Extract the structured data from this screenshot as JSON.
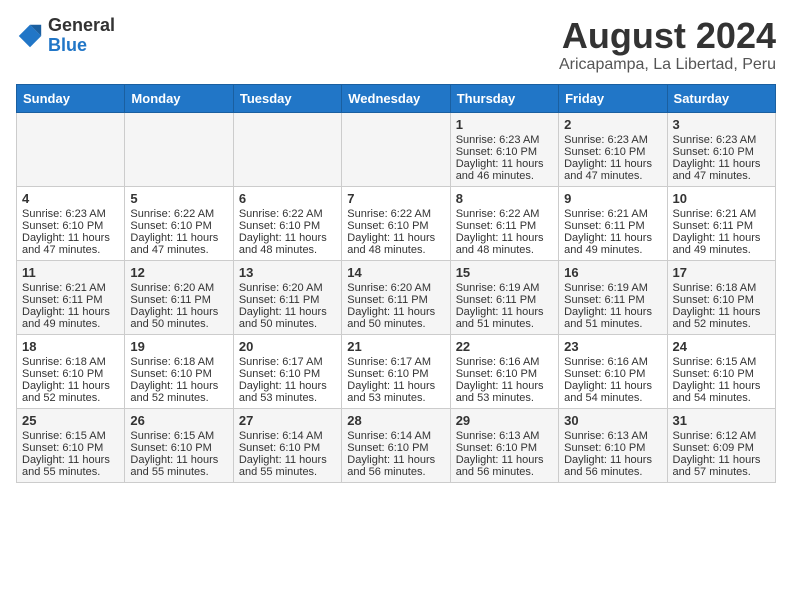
{
  "header": {
    "logo_line1": "General",
    "logo_line2": "Blue",
    "title": "August 2024",
    "subtitle": "Aricapampa, La Libertad, Peru"
  },
  "weekdays": [
    "Sunday",
    "Monday",
    "Tuesday",
    "Wednesday",
    "Thursday",
    "Friday",
    "Saturday"
  ],
  "weeks": [
    [
      {
        "day": "",
        "info": ""
      },
      {
        "day": "",
        "info": ""
      },
      {
        "day": "",
        "info": ""
      },
      {
        "day": "",
        "info": ""
      },
      {
        "day": "1",
        "info": "Sunrise: 6:23 AM\nSunset: 6:10 PM\nDaylight: 11 hours\nand 46 minutes."
      },
      {
        "day": "2",
        "info": "Sunrise: 6:23 AM\nSunset: 6:10 PM\nDaylight: 11 hours\nand 47 minutes."
      },
      {
        "day": "3",
        "info": "Sunrise: 6:23 AM\nSunset: 6:10 PM\nDaylight: 11 hours\nand 47 minutes."
      }
    ],
    [
      {
        "day": "4",
        "info": "Sunrise: 6:23 AM\nSunset: 6:10 PM\nDaylight: 11 hours\nand 47 minutes."
      },
      {
        "day": "5",
        "info": "Sunrise: 6:22 AM\nSunset: 6:10 PM\nDaylight: 11 hours\nand 47 minutes."
      },
      {
        "day": "6",
        "info": "Sunrise: 6:22 AM\nSunset: 6:10 PM\nDaylight: 11 hours\nand 48 minutes."
      },
      {
        "day": "7",
        "info": "Sunrise: 6:22 AM\nSunset: 6:10 PM\nDaylight: 11 hours\nand 48 minutes."
      },
      {
        "day": "8",
        "info": "Sunrise: 6:22 AM\nSunset: 6:11 PM\nDaylight: 11 hours\nand 48 minutes."
      },
      {
        "day": "9",
        "info": "Sunrise: 6:21 AM\nSunset: 6:11 PM\nDaylight: 11 hours\nand 49 minutes."
      },
      {
        "day": "10",
        "info": "Sunrise: 6:21 AM\nSunset: 6:11 PM\nDaylight: 11 hours\nand 49 minutes."
      }
    ],
    [
      {
        "day": "11",
        "info": "Sunrise: 6:21 AM\nSunset: 6:11 PM\nDaylight: 11 hours\nand 49 minutes."
      },
      {
        "day": "12",
        "info": "Sunrise: 6:20 AM\nSunset: 6:11 PM\nDaylight: 11 hours\nand 50 minutes."
      },
      {
        "day": "13",
        "info": "Sunrise: 6:20 AM\nSunset: 6:11 PM\nDaylight: 11 hours\nand 50 minutes."
      },
      {
        "day": "14",
        "info": "Sunrise: 6:20 AM\nSunset: 6:11 PM\nDaylight: 11 hours\nand 50 minutes."
      },
      {
        "day": "15",
        "info": "Sunrise: 6:19 AM\nSunset: 6:11 PM\nDaylight: 11 hours\nand 51 minutes."
      },
      {
        "day": "16",
        "info": "Sunrise: 6:19 AM\nSunset: 6:11 PM\nDaylight: 11 hours\nand 51 minutes."
      },
      {
        "day": "17",
        "info": "Sunrise: 6:18 AM\nSunset: 6:10 PM\nDaylight: 11 hours\nand 52 minutes."
      }
    ],
    [
      {
        "day": "18",
        "info": "Sunrise: 6:18 AM\nSunset: 6:10 PM\nDaylight: 11 hours\nand 52 minutes."
      },
      {
        "day": "19",
        "info": "Sunrise: 6:18 AM\nSunset: 6:10 PM\nDaylight: 11 hours\nand 52 minutes."
      },
      {
        "day": "20",
        "info": "Sunrise: 6:17 AM\nSunset: 6:10 PM\nDaylight: 11 hours\nand 53 minutes."
      },
      {
        "day": "21",
        "info": "Sunrise: 6:17 AM\nSunset: 6:10 PM\nDaylight: 11 hours\nand 53 minutes."
      },
      {
        "day": "22",
        "info": "Sunrise: 6:16 AM\nSunset: 6:10 PM\nDaylight: 11 hours\nand 53 minutes."
      },
      {
        "day": "23",
        "info": "Sunrise: 6:16 AM\nSunset: 6:10 PM\nDaylight: 11 hours\nand 54 minutes."
      },
      {
        "day": "24",
        "info": "Sunrise: 6:15 AM\nSunset: 6:10 PM\nDaylight: 11 hours\nand 54 minutes."
      }
    ],
    [
      {
        "day": "25",
        "info": "Sunrise: 6:15 AM\nSunset: 6:10 PM\nDaylight: 11 hours\nand 55 minutes."
      },
      {
        "day": "26",
        "info": "Sunrise: 6:15 AM\nSunset: 6:10 PM\nDaylight: 11 hours\nand 55 minutes."
      },
      {
        "day": "27",
        "info": "Sunrise: 6:14 AM\nSunset: 6:10 PM\nDaylight: 11 hours\nand 55 minutes."
      },
      {
        "day": "28",
        "info": "Sunrise: 6:14 AM\nSunset: 6:10 PM\nDaylight: 11 hours\nand 56 minutes."
      },
      {
        "day": "29",
        "info": "Sunrise: 6:13 AM\nSunset: 6:10 PM\nDaylight: 11 hours\nand 56 minutes."
      },
      {
        "day": "30",
        "info": "Sunrise: 6:13 AM\nSunset: 6:10 PM\nDaylight: 11 hours\nand 56 minutes."
      },
      {
        "day": "31",
        "info": "Sunrise: 6:12 AM\nSunset: 6:09 PM\nDaylight: 11 hours\nand 57 minutes."
      }
    ]
  ]
}
